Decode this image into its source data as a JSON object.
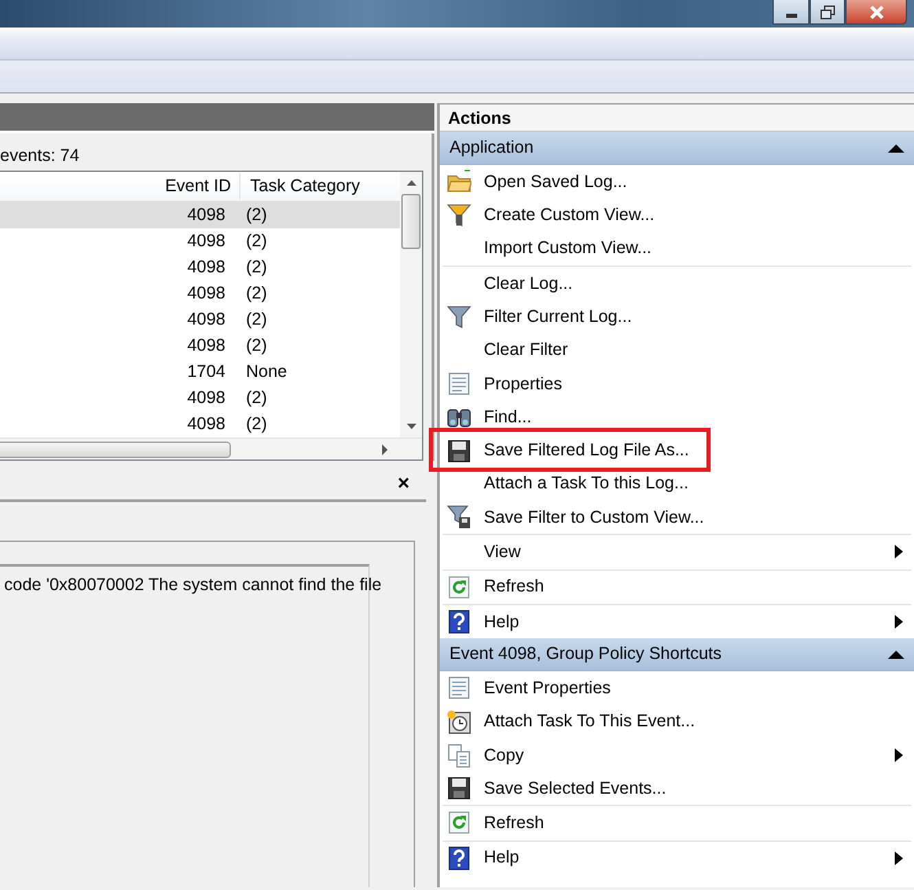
{
  "events_panel": {
    "event_count": "events: 74",
    "columns": [
      "Event ID",
      "Task Category"
    ],
    "rows": [
      {
        "event_id": "4098",
        "task_category": "(2)",
        "selected": true
      },
      {
        "event_id": "4098",
        "task_category": "(2)",
        "selected": false
      },
      {
        "event_id": "4098",
        "task_category": "(2)",
        "selected": false
      },
      {
        "event_id": "4098",
        "task_category": "(2)",
        "selected": false
      },
      {
        "event_id": "4098",
        "task_category": "(2)",
        "selected": false
      },
      {
        "event_id": "4098",
        "task_category": "(2)",
        "selected": false
      },
      {
        "event_id": "1704",
        "task_category": "None",
        "selected": false
      },
      {
        "event_id": "4098",
        "task_category": "(2)",
        "selected": false
      },
      {
        "event_id": "4098",
        "task_category": "(2)",
        "selected": false
      }
    ]
  },
  "details_panel": {
    "close": "×",
    "text": "code '0x80070002 The system cannot find the file"
  },
  "actions": {
    "title": "Actions",
    "sections": [
      {
        "title": "Application",
        "expanded": true,
        "groups": [
          [
            {
              "label": "Open Saved Log...",
              "kind": "folder",
              "submenu": false,
              "highlighted": false
            },
            {
              "label": "Create Custom View...",
              "kind": "funnel",
              "submenu": false,
              "highlighted": false
            },
            {
              "label": "Import Custom View...",
              "kind": "none",
              "submenu": false,
              "highlighted": false
            }
          ],
          [
            {
              "label": "Clear Log...",
              "kind": "none",
              "submenu": false,
              "highlighted": false
            },
            {
              "label": "Filter Current Log...",
              "kind": "funnel-grey",
              "submenu": false,
              "highlighted": false
            },
            {
              "label": "Clear Filter",
              "kind": "none",
              "submenu": false,
              "highlighted": false
            },
            {
              "label": "Properties",
              "kind": "properties",
              "submenu": false,
              "highlighted": false
            },
            {
              "label": "Find...",
              "kind": "binoculars",
              "submenu": false,
              "highlighted": false
            },
            {
              "label": "Save Filtered Log File As...",
              "kind": "floppy",
              "submenu": false,
              "highlighted": true
            },
            {
              "label": "Attach a Task To this Log...",
              "kind": "none",
              "submenu": false,
              "highlighted": false
            },
            {
              "label": "Save Filter to Custom View...",
              "kind": "funnel-save",
              "submenu": false,
              "highlighted": false
            }
          ],
          [
            {
              "label": "View",
              "kind": "none",
              "submenu": true,
              "highlighted": false
            }
          ],
          [
            {
              "label": "Refresh",
              "kind": "refresh",
              "submenu": false,
              "highlighted": false
            }
          ],
          [
            {
              "label": "Help",
              "kind": "help",
              "submenu": true,
              "highlighted": false
            }
          ]
        ]
      },
      {
        "title": "Event 4098, Group Policy Shortcuts",
        "expanded": true,
        "groups": [
          [
            {
              "label": "Event Properties",
              "kind": "properties",
              "submenu": false,
              "highlighted": false
            },
            {
              "label": "Attach Task To This Event...",
              "kind": "clock",
              "submenu": false,
              "highlighted": false
            },
            {
              "label": "Copy",
              "kind": "copy",
              "submenu": true,
              "highlighted": false
            },
            {
              "label": "Save Selected Events...",
              "kind": "floppy",
              "submenu": false,
              "highlighted": false
            }
          ],
          [
            {
              "label": "Refresh",
              "kind": "refresh",
              "submenu": false,
              "highlighted": false
            }
          ],
          [
            {
              "label": "Help",
              "kind": "help",
              "submenu": true,
              "highlighted": false
            }
          ]
        ]
      }
    ]
  }
}
